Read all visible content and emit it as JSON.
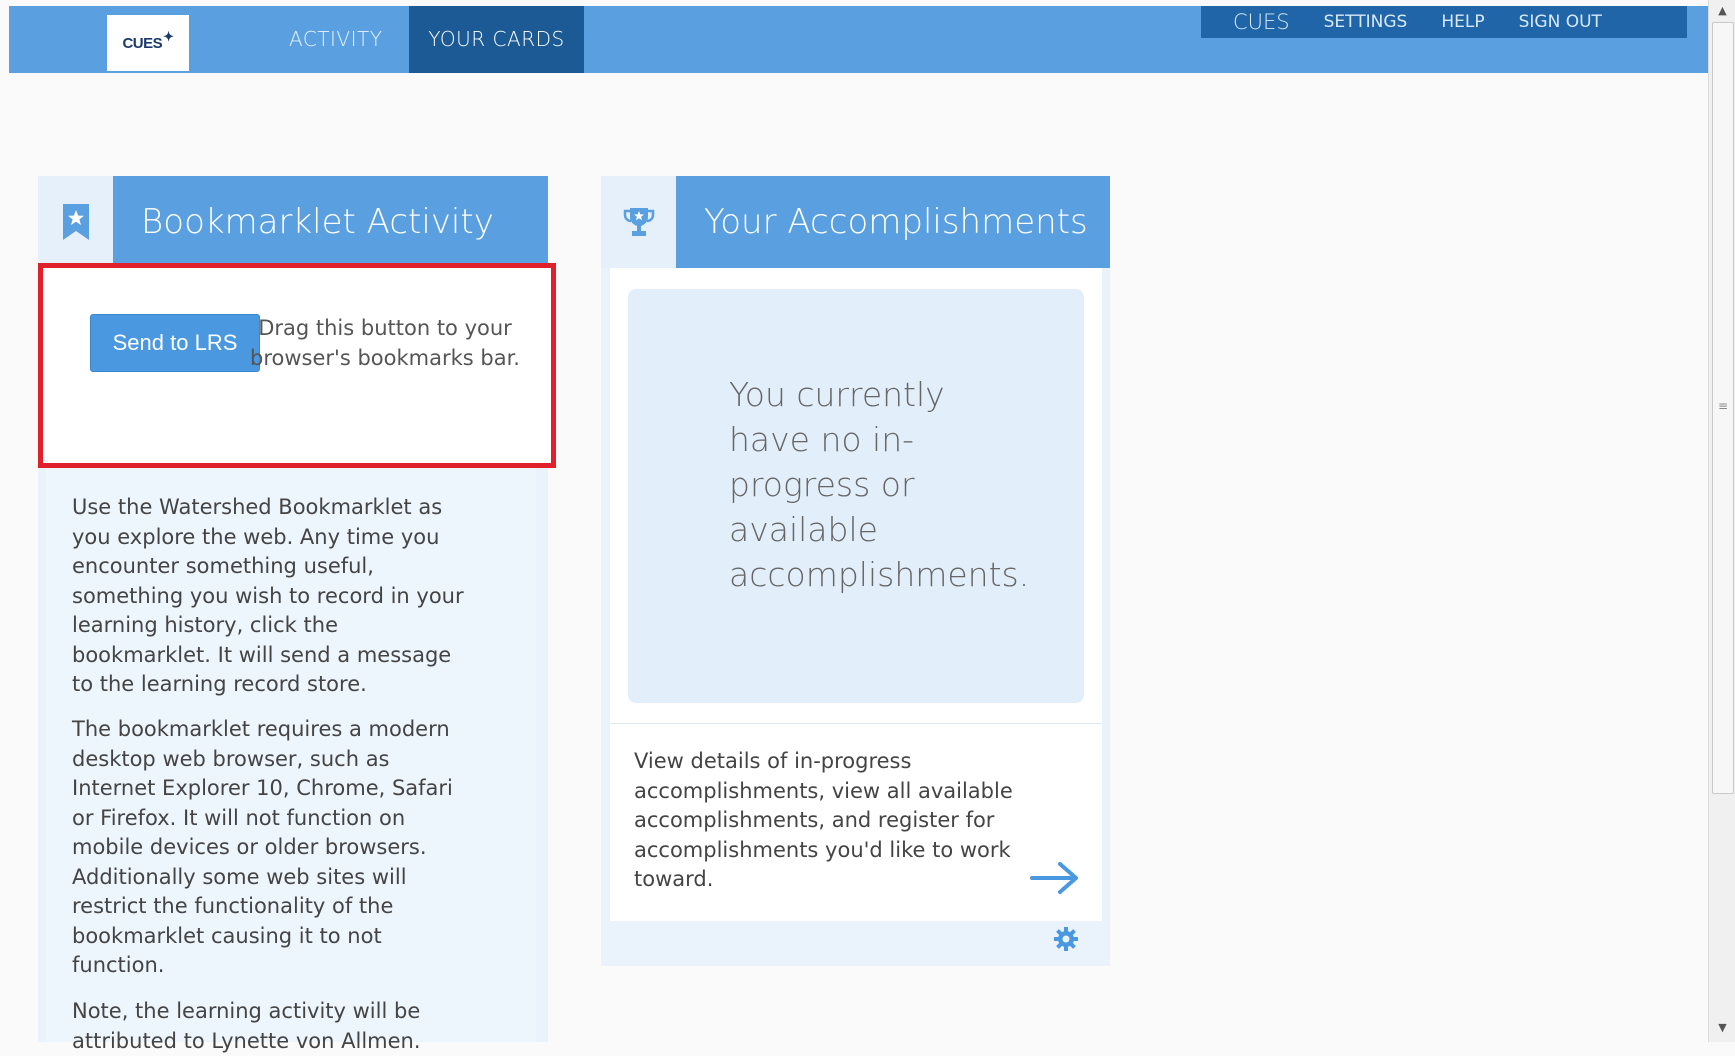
{
  "nav": {
    "logo_text": "CUES",
    "tabs": [
      {
        "label": "ACTIVITY",
        "active": false
      },
      {
        "label": "YOUR CARDS",
        "active": true
      }
    ],
    "utility": [
      "CUES",
      "SETTINGS",
      "HELP",
      "SIGN OUT"
    ]
  },
  "colors": {
    "accent": "#5aa0e0",
    "nav_active": "#1c5a96",
    "highlight_box": "#e0202a"
  },
  "bookmarklet_card": {
    "icon": "bookmark-star-icon",
    "title": "Bookmarklet Activity",
    "button_label": "Send to LRS",
    "drag_text": "Drag this button to your browser's bookmarks bar.",
    "paragraph_1": "Use the Watershed Bookmarklet as you explore the web. Any time you encounter something useful, something you wish to record in your learning history, click the bookmarklet. It will send a message to the learning record store.",
    "paragraph_2": "The bookmarklet requires a modern desktop web browser, such as Internet Explorer 10, Chrome, Safari or Firefox. It will not function on mobile devices or older browsers. Additionally some web sites will restrict the functionality of the bookmarklet causing it to not function.",
    "paragraph_3": "Note, the learning activity will be attributed to Lynette von Allmen."
  },
  "accomplishments_card": {
    "icon": "trophy-icon",
    "title": "Your Accomplishments",
    "empty_message": "You currently have no in-progress or available accomplishments.",
    "details_text": "View details of in-progress accomplishments, view all available accomplishments, and register for accomplishments you'd like to work toward.",
    "arrow_icon": "arrow-right-icon",
    "settings_icon": "gear-icon"
  }
}
